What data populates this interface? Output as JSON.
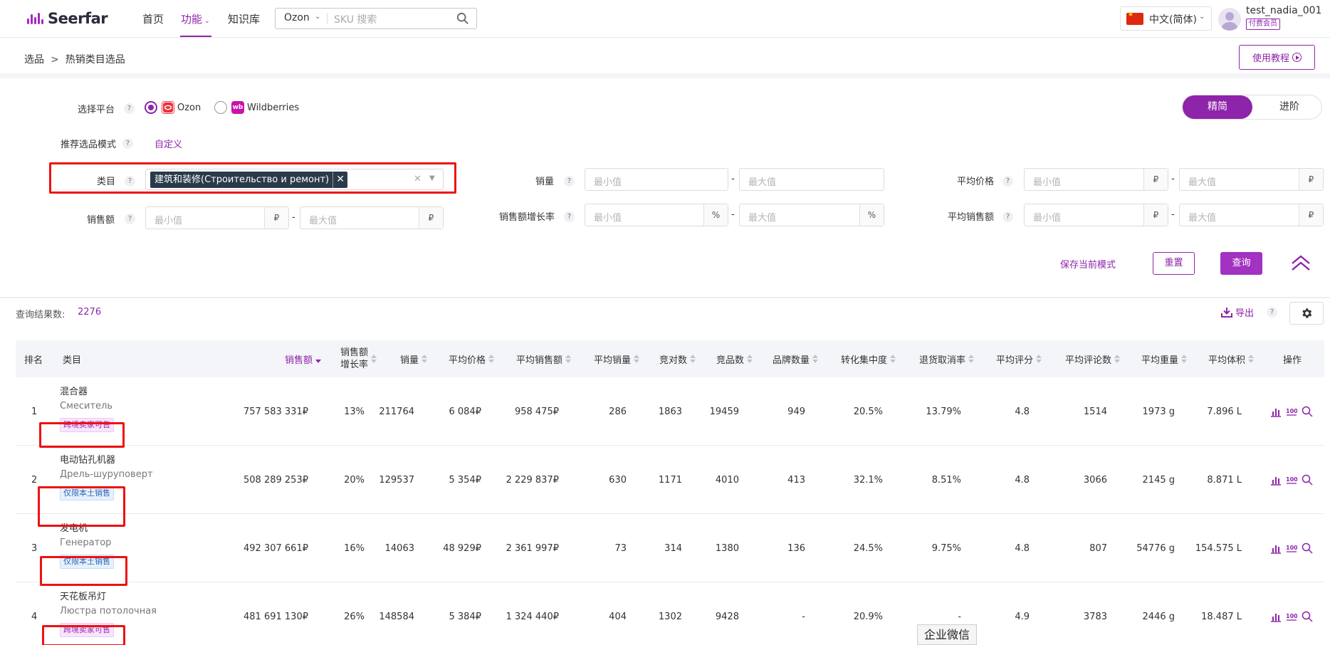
{
  "app": {
    "brand": "Seerfar",
    "colors": {
      "accent": "#8e24aa",
      "accent_button": "#a232c1",
      "highlight_box": "#ee1111"
    }
  },
  "nav": {
    "items": [
      {
        "label": "首页"
      },
      {
        "label": "功能",
        "active": true
      },
      {
        "label": "知识库"
      }
    ],
    "search": {
      "platform": "Ozon",
      "placeholder": "SKU 搜索"
    },
    "language": "中文(简体)",
    "user": {
      "name": "test_nadia_001",
      "badge": "付费会员"
    }
  },
  "breadcrumb": {
    "root": "选品",
    "separator": ">",
    "current": "热销类目选品"
  },
  "tutorial_button": "使用教程",
  "filters": {
    "platform": {
      "label": "选择平台",
      "options": [
        {
          "label": "Ozon",
          "selected": true
        },
        {
          "label": "Wildberries",
          "selected": false
        }
      ]
    },
    "mode": {
      "label": "推荐选品模式",
      "value": "自定义"
    },
    "category": {
      "label": "类目",
      "tag": "建筑和装修(Строительство и ремонт)"
    },
    "sales_amount": {
      "label": "销售额",
      "min_placeholder": "最小值",
      "max_placeholder": "最大值",
      "unit": "₽"
    },
    "sales_volume": {
      "label": "销量",
      "min_placeholder": "最小值",
      "max_placeholder": "最大值"
    },
    "sales_growth": {
      "label": "销售额增长率",
      "min_placeholder": "最小值",
      "max_placeholder": "最大值",
      "unit": "%"
    },
    "avg_price": {
      "label": "平均价格",
      "min_placeholder": "最小值",
      "max_placeholder": "最大值",
      "unit": "₽"
    },
    "avg_sales_amount": {
      "label": "平均销售额",
      "min_placeholder": "最小值",
      "max_placeholder": "最大值",
      "unit": "₽"
    },
    "dash": "-",
    "view_toggle": {
      "on": "精简",
      "off": "进阶"
    },
    "actions": {
      "save": "保存当前模式",
      "reset": "重置",
      "query": "查询"
    }
  },
  "results": {
    "label": "查询结果数:",
    "count": "2276",
    "export": "导出"
  },
  "table": {
    "columns": [
      {
        "key": "rank",
        "label": "排名"
      },
      {
        "key": "category",
        "label": "类目"
      },
      {
        "key": "sales",
        "label": "销售额",
        "sorted": "desc"
      },
      {
        "key": "growth",
        "label": "销售额增长率",
        "label_line1": "销售额",
        "label_line2": "增长率"
      },
      {
        "key": "volume",
        "label": "销量"
      },
      {
        "key": "avg_price",
        "label": "平均价格"
      },
      {
        "key": "avg_sales",
        "label": "平均销售额"
      },
      {
        "key": "avg_volume",
        "label": "平均销量"
      },
      {
        "key": "competitors",
        "label": "竞对数"
      },
      {
        "key": "products",
        "label": "竞品数"
      },
      {
        "key": "brands",
        "label": "品牌数量"
      },
      {
        "key": "concentration",
        "label": "转化集中度"
      },
      {
        "key": "return_rate",
        "label": "退货取消率"
      },
      {
        "key": "avg_rating",
        "label": "平均评分"
      },
      {
        "key": "avg_reviews",
        "label": "平均评论数"
      },
      {
        "key": "avg_weight",
        "label": "平均重量"
      },
      {
        "key": "avg_volume_l",
        "label": "平均体积"
      },
      {
        "key": "actions",
        "label": "操作"
      }
    ],
    "rows": [
      {
        "rank": "1",
        "name_zh": "混合器",
        "name_ru": "Смеситель",
        "tag": "跨境卖家可售",
        "tag_type": "cross",
        "sales": "757 583 331₽",
        "growth": "13%",
        "volume": "211764",
        "avg_price": "6 084₽",
        "avg_sales": "958 475₽",
        "avg_volume": "286",
        "competitors": "1863",
        "products": "19459",
        "brands": "949",
        "concentration": "20.5%",
        "return_rate": "13.79%",
        "avg_rating": "4.8",
        "avg_reviews": "1514",
        "avg_weight": "1973 g",
        "avg_volume_l": "7.896 L"
      },
      {
        "rank": "2",
        "name_zh": "电动钻孔机器",
        "name_ru": "Дрель-шуруповерт",
        "tag": "仅限本土销售",
        "tag_type": "local",
        "sales": "508 289 253₽",
        "growth": "20%",
        "volume": "129537",
        "avg_price": "5 354₽",
        "avg_sales": "2 229 837₽",
        "avg_volume": "630",
        "competitors": "1171",
        "products": "4010",
        "brands": "413",
        "concentration": "32.1%",
        "return_rate": "8.51%",
        "avg_rating": "4.8",
        "avg_reviews": "3066",
        "avg_weight": "2145 g",
        "avg_volume_l": "8.871 L"
      },
      {
        "rank": "3",
        "name_zh": "发电机",
        "name_ru": "Генератор",
        "tag": "仅限本土销售",
        "tag_type": "local",
        "sales": "492 307 661₽",
        "growth": "16%",
        "volume": "14063",
        "avg_price": "48 929₽",
        "avg_sales": "2 361 997₽",
        "avg_volume": "73",
        "competitors": "314",
        "products": "1380",
        "brands": "136",
        "concentration": "24.5%",
        "return_rate": "9.75%",
        "avg_rating": "4.8",
        "avg_reviews": "807",
        "avg_weight": "54776 g",
        "avg_volume_l": "154.575 L"
      },
      {
        "rank": "4",
        "name_zh": "天花板吊灯",
        "name_ru": "Люстра потолочная",
        "tag": "跨境卖家可售",
        "tag_type": "cross",
        "sales": "481 691 130₽",
        "growth": "26%",
        "volume": "148584",
        "avg_price": "5 384₽",
        "avg_sales": "1 324 440₽",
        "avg_volume": "404",
        "competitors": "1302",
        "products": "9428",
        "brands": "-",
        "concentration": "20.9%",
        "return_rate": "-",
        "avg_rating": "4.9",
        "avg_reviews": "3783",
        "avg_weight": "2446 g",
        "avg_volume_l": "18.487 L"
      }
    ]
  },
  "watermark": "企业微信"
}
